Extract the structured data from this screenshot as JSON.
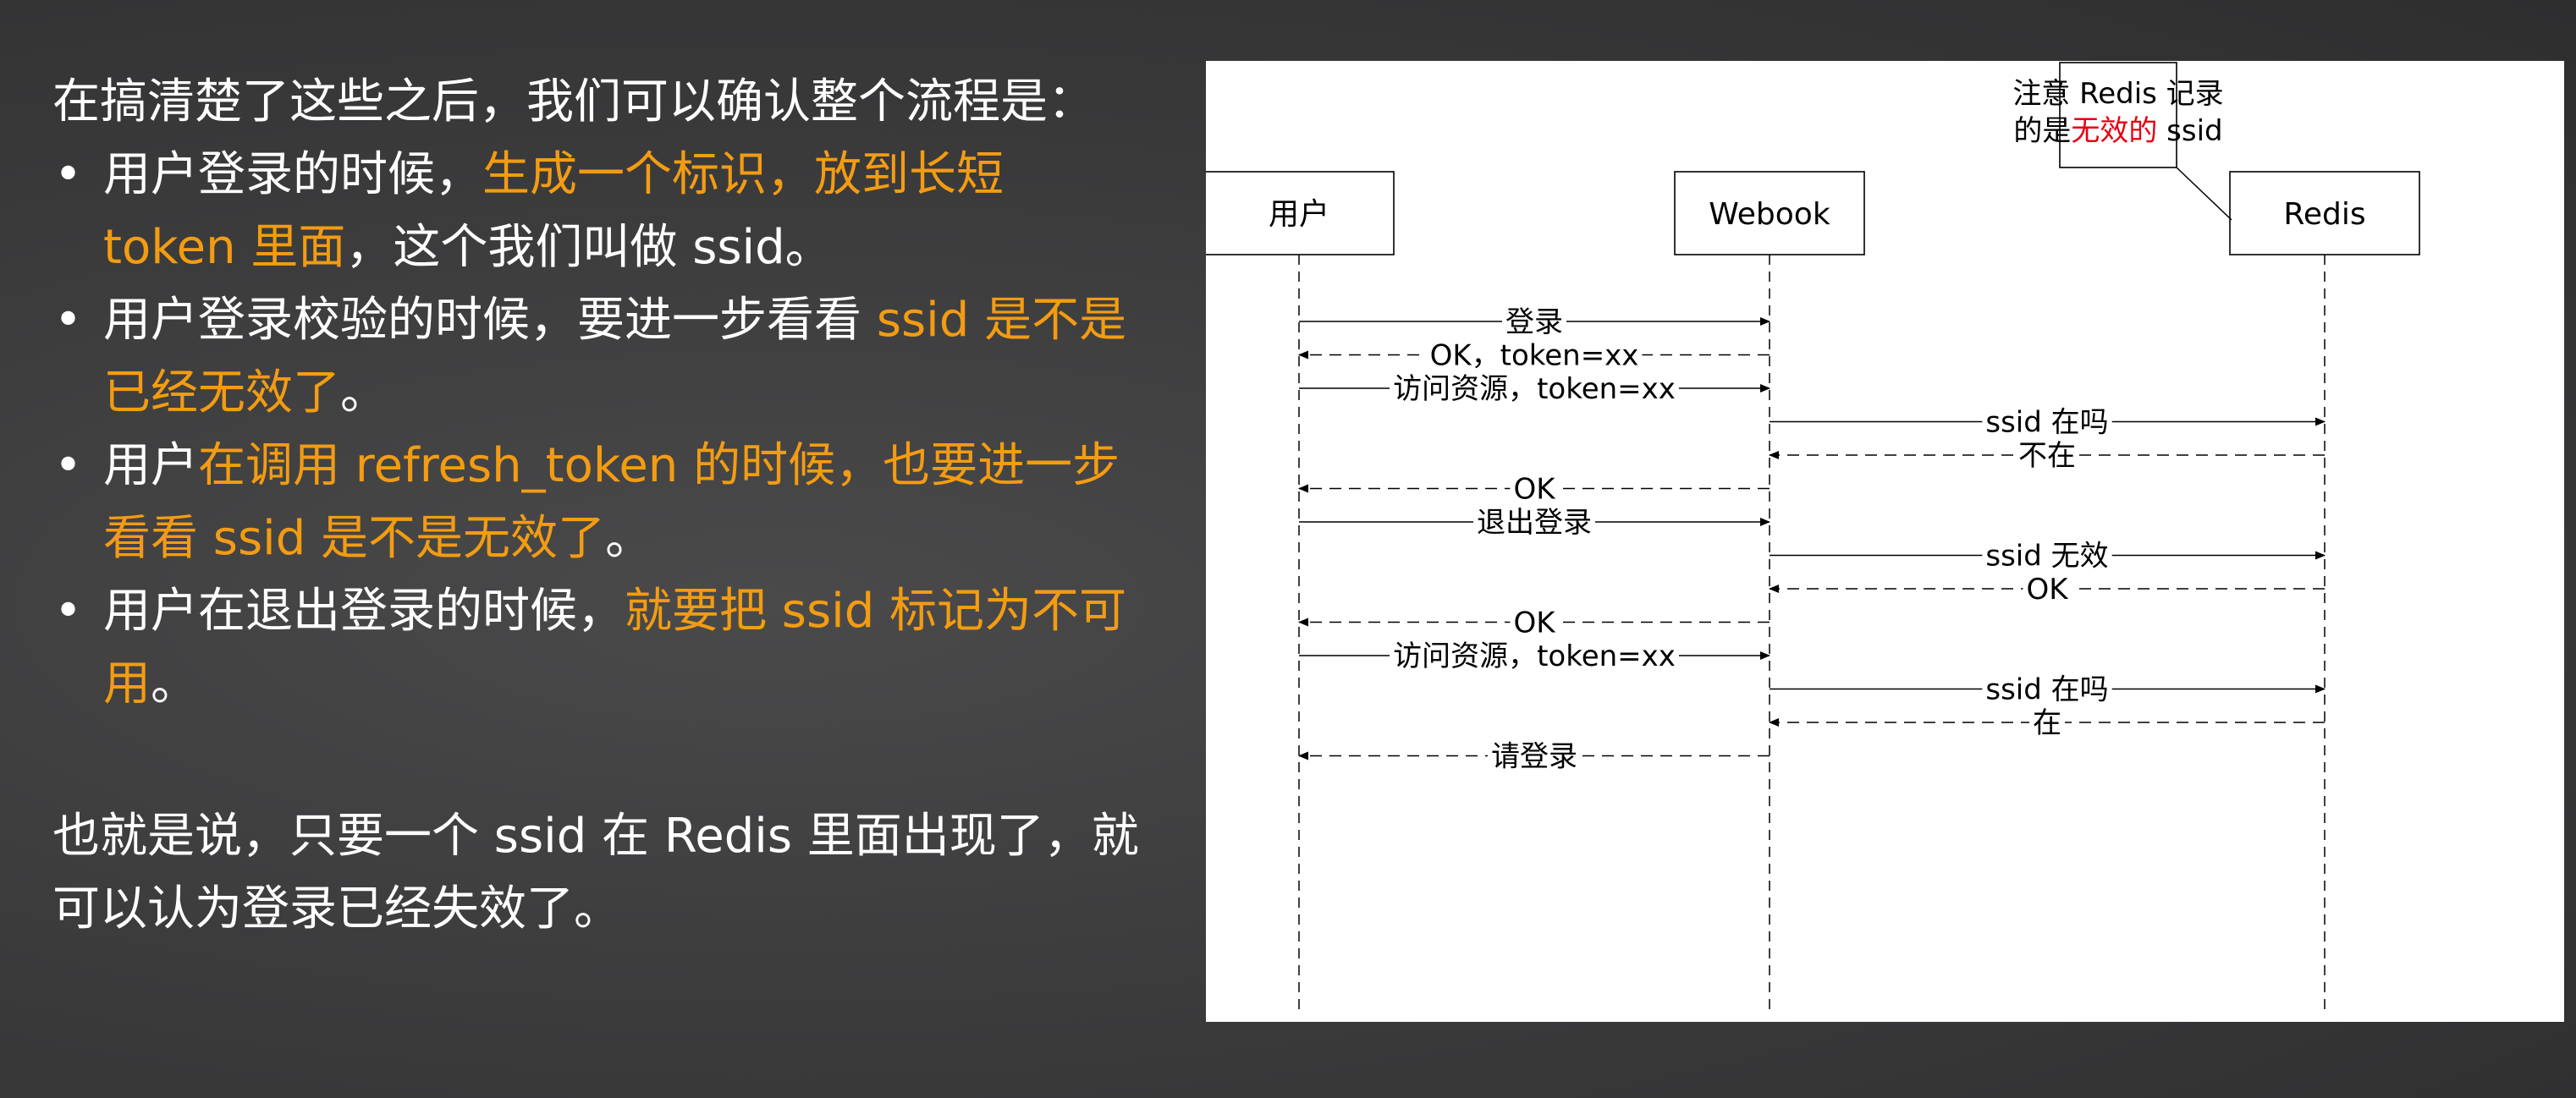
{
  "text": {
    "intro": "在搞清楚了这些之后，我们可以确认整个流程是：",
    "bullets": [
      {
        "parts": [
          {
            "text": "用户登录的时候，",
            "highlight": false
          },
          {
            "text": "生成一个标识，放到长短 token 里面",
            "highlight": true
          },
          {
            "text": "，这个我们叫做 ssid。",
            "highlight": false
          }
        ]
      },
      {
        "parts": [
          {
            "text": "用户登录校验的时候，要进一步看看 ",
            "highlight": false
          },
          {
            "text": "ssid 是不是已经无效了",
            "highlight": true
          },
          {
            "text": "。",
            "highlight": false
          }
        ]
      },
      {
        "parts": [
          {
            "text": "用户",
            "highlight": false
          },
          {
            "text": "在调用 refresh_token 的时候，也要进一步看看 ssid 是不是无效了",
            "highlight": true
          },
          {
            "text": "。",
            "highlight": false
          }
        ]
      },
      {
        "parts": [
          {
            "text": "用户在退出登录的时候，",
            "highlight": false
          },
          {
            "text": "就要把 ssid 标记为不可用",
            "highlight": true
          },
          {
            "text": "。",
            "highlight": false
          }
        ]
      }
    ],
    "summary": "也就是说，只要一个 ssid 在 Redis 里面出现了，就可以认为登录已经失效了。"
  },
  "colors": {
    "highlight": "#f39c12",
    "note_red": "#e60012",
    "line": "#000000"
  },
  "diagram": {
    "participants": [
      {
        "id": "user",
        "label": "用户"
      },
      {
        "id": "webook",
        "label": "Webook"
      },
      {
        "id": "redis",
        "label": "Redis"
      }
    ],
    "note": {
      "line1": "注意 Redis 记录",
      "line2_prefix": "的是",
      "line2_red": "无效的",
      "line2_suffix": " ssid"
    },
    "messages": [
      {
        "from": "user",
        "to": "webook",
        "label": "登录",
        "dashed": false
      },
      {
        "from": "webook",
        "to": "user",
        "label": "OK，token=xx",
        "dashed": true
      },
      {
        "from": "user",
        "to": "webook",
        "label": "访问资源，token=xx",
        "dashed": false
      },
      {
        "from": "webook",
        "to": "redis",
        "label": "ssid 在吗",
        "dashed": false
      },
      {
        "from": "redis",
        "to": "webook",
        "label": "不在",
        "dashed": true
      },
      {
        "from": "webook",
        "to": "user",
        "label": "OK",
        "dashed": true
      },
      {
        "from": "user",
        "to": "webook",
        "label": "退出登录",
        "dashed": false
      },
      {
        "from": "webook",
        "to": "redis",
        "label": "ssid 无效",
        "dashed": false
      },
      {
        "from": "redis",
        "to": "webook",
        "label": "OK",
        "dashed": true
      },
      {
        "from": "webook",
        "to": "user",
        "label": "OK",
        "dashed": true
      },
      {
        "from": "user",
        "to": "webook",
        "label": "访问资源，token=xx",
        "dashed": false
      },
      {
        "from": "webook",
        "to": "redis",
        "label": "ssid 在吗",
        "dashed": false
      },
      {
        "from": "redis",
        "to": "webook",
        "label": "在",
        "dashed": true
      },
      {
        "from": "webook",
        "to": "user",
        "label": "请登录",
        "dashed": true
      }
    ]
  }
}
